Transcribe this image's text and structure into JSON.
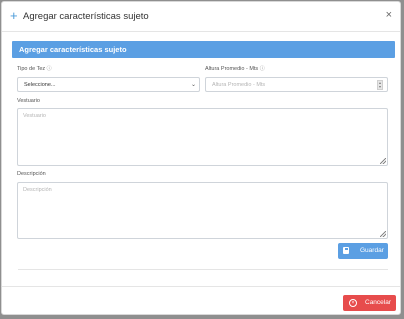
{
  "modal": {
    "title": "Agregar características sujeto",
    "plus_icon": "+",
    "close_icon": "×"
  },
  "panel": {
    "heading": "Agregar características sujeto"
  },
  "form": {
    "tipo_label": "Tipo de Tez",
    "tipo_selected": "Seleccione...",
    "altura_label": "Altura Promedio - Mts",
    "altura_placeholder": "Altura Promedio - Mts",
    "vestuario_label": "Vestuario",
    "vestuario_placeholder": "Vestuario",
    "descripcion_label": "Descripción",
    "descripcion_placeholder": "Descripción"
  },
  "buttons": {
    "save_label": "Guardar",
    "cancel_label": "Cancelar",
    "save_color": "#5b9fe3",
    "cancel_color": "#e74c4c"
  },
  "icons": {
    "save": "save-icon",
    "cancel": "cancel-circle-icon",
    "help": "help-icon",
    "caret": "chevron-down-icon"
  }
}
